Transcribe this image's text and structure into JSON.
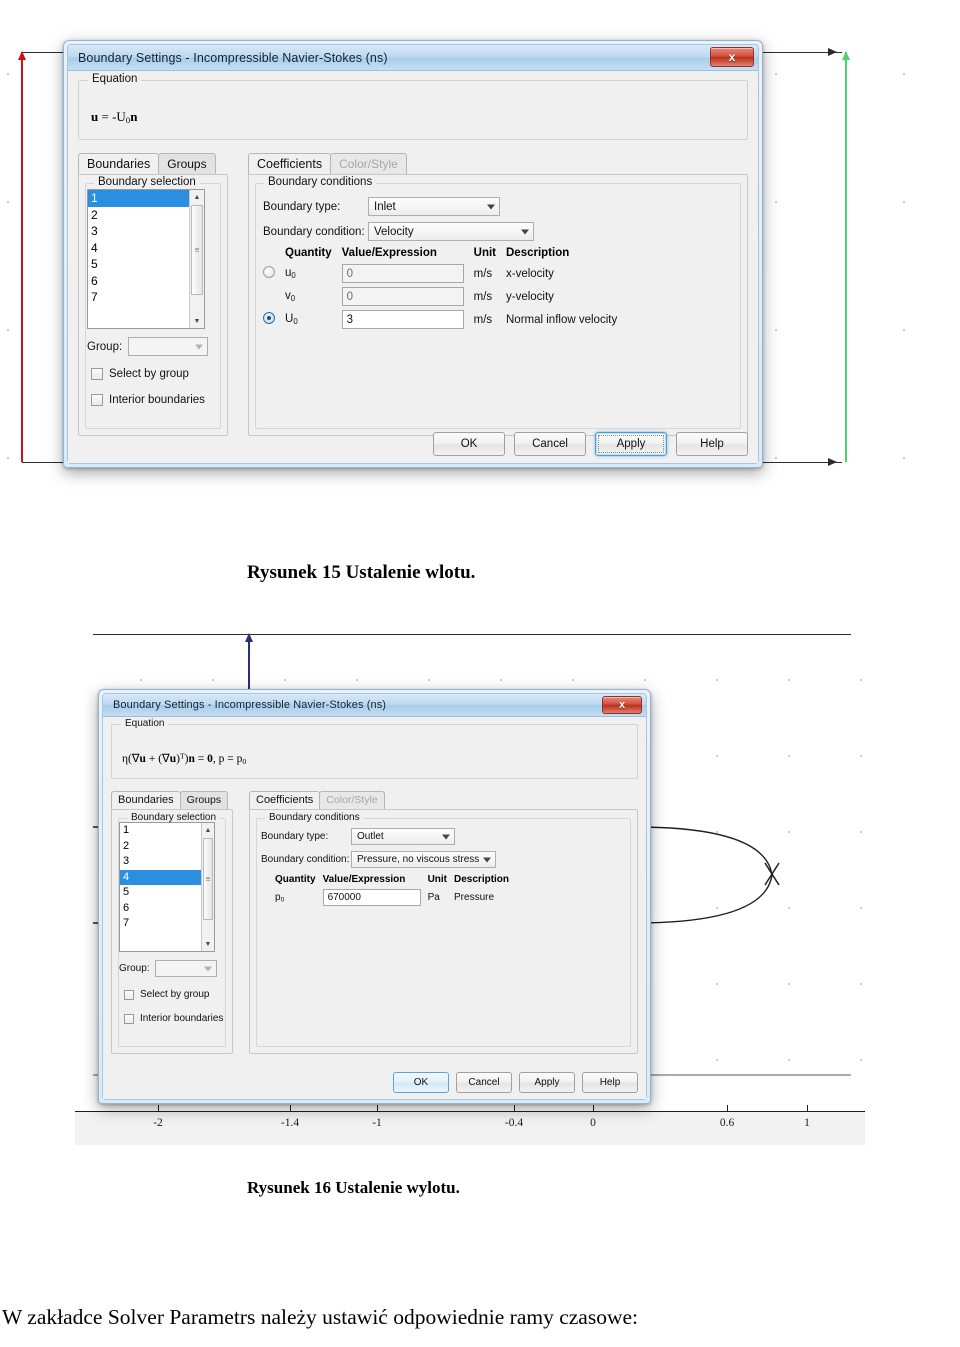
{
  "figure1": {
    "background": {
      "arrows": {
        "left_vertical_color": "#cc1111",
        "right_vertical_color": "#4fd26a",
        "horizontal_color": "#2b2b2b"
      }
    },
    "dialog": {
      "title": "Boundary Settings - Incompressible Navier-Stokes (ns)",
      "close_label": "x",
      "equation_group": "Equation",
      "equation": "u = -U₀n",
      "tabs_left": [
        {
          "label": "Boundaries",
          "active": true,
          "disabled": false
        },
        {
          "label": "Groups",
          "active": false,
          "disabled": false
        }
      ],
      "tabs_right": [
        {
          "label": "Coefficients",
          "active": true,
          "disabled": false
        },
        {
          "label": "Color/Style",
          "active": false,
          "disabled": true
        }
      ],
      "boundary_selection_label": "Boundary selection",
      "boundary_items": [
        "1",
        "2",
        "3",
        "4",
        "5",
        "6",
        "7"
      ],
      "selected_boundary": "1",
      "group_label": "Group:",
      "group_value": "",
      "select_by_group_label": "Select by group",
      "interior_boundaries_label": "Interior boundaries",
      "boundary_conditions_label": "Boundary conditions",
      "boundary_type_label": "Boundary type:",
      "boundary_type_value": "Inlet",
      "boundary_condition_label": "Boundary condition:",
      "boundary_condition_value": "Velocity",
      "table_headers": [
        "Quantity",
        "Value/Expression",
        "Unit",
        "Description"
      ],
      "rows": [
        {
          "radio": "off",
          "quantity": "u₀",
          "value": "0",
          "unit": "m/s",
          "description": "x-velocity",
          "readonly": true
        },
        {
          "radio": "none",
          "quantity": "v₀",
          "value": "0",
          "unit": "m/s",
          "description": "y-velocity",
          "readonly": true
        },
        {
          "radio": "on",
          "quantity": "U₀",
          "value": "3",
          "unit": "m/s",
          "description": "Normal inflow velocity",
          "readonly": false
        }
      ],
      "buttons": [
        {
          "label": "OK",
          "state": "normal"
        },
        {
          "label": "Cancel",
          "state": "normal"
        },
        {
          "label": "Apply",
          "state": "focus"
        },
        {
          "label": "Help",
          "state": "normal"
        }
      ]
    }
  },
  "caption_15": "Rysunek 15 Ustalenie wlotu.",
  "figure2": {
    "background": {
      "arrow_up_color": "#2b2f7a"
    },
    "axis": {
      "ticks": [
        "-2",
        "-1.4",
        "-1",
        "-0.4",
        "0",
        "0.6",
        "1"
      ],
      "positions": [
        0.105,
        0.273,
        0.382,
        0.555,
        0.655,
        0.825,
        0.925
      ]
    },
    "dialog": {
      "title": "Boundary Settings - Incompressible Navier-Stokes (ns)",
      "close_label": "x",
      "equation_group": "Equation",
      "equation": "η(∇u + (∇u)ᵀ)n = 0, p = p₀",
      "tabs_left": [
        {
          "label": "Boundaries",
          "active": true,
          "disabled": false
        },
        {
          "label": "Groups",
          "active": false,
          "disabled": false
        }
      ],
      "tabs_right": [
        {
          "label": "Coefficients",
          "active": true,
          "disabled": false
        },
        {
          "label": "Color/Style",
          "active": false,
          "disabled": true
        }
      ],
      "boundary_selection_label": "Boundary selection",
      "boundary_items": [
        "1",
        "2",
        "3",
        "4",
        "5",
        "6",
        "7"
      ],
      "selected_boundary": "4",
      "group_label": "Group:",
      "group_value": "",
      "select_by_group_label": "Select by group",
      "interior_boundaries_label": "Interior boundaries",
      "boundary_conditions_label": "Boundary conditions",
      "boundary_type_label": "Boundary type:",
      "boundary_type_value": "Outlet",
      "boundary_condition_label": "Boundary condition:",
      "boundary_condition_value": "Pressure, no viscous stress",
      "table_headers": [
        "Quantity",
        "Value/Expression",
        "Unit",
        "Description"
      ],
      "rows": [
        {
          "radio": "none",
          "quantity": "p₀",
          "value": "670000",
          "unit": "Pa",
          "description": "Pressure",
          "readonly": false
        }
      ],
      "buttons": [
        {
          "label": "OK",
          "state": "default"
        },
        {
          "label": "Cancel",
          "state": "normal"
        },
        {
          "label": "Apply",
          "state": "normal"
        },
        {
          "label": "Help",
          "state": "normal"
        }
      ]
    }
  },
  "caption_16": "Rysunek 16 Ustalenie wylotu.",
  "body_text": "W zakładce Solver Parametrs należy ustawić odpowiednie ramy czasowe:"
}
